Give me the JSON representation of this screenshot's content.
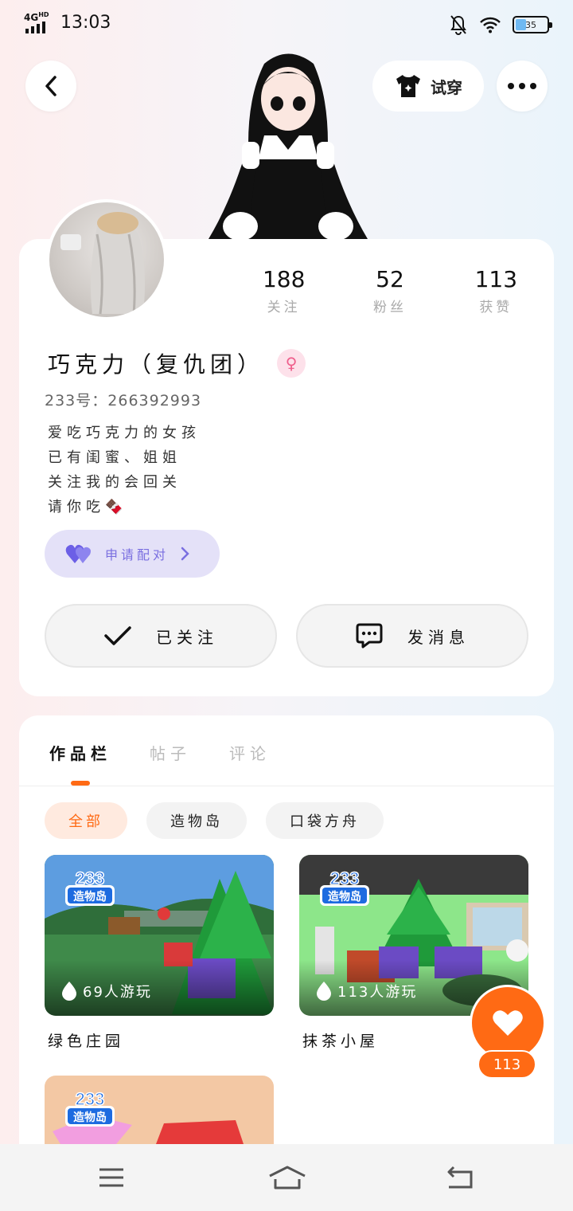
{
  "status_bar": {
    "network": "4G",
    "network_sub": "HD",
    "time": "13:03",
    "battery": "35"
  },
  "header": {
    "try_on_label": "试穿"
  },
  "profile": {
    "stats": [
      {
        "value": "188",
        "label": "关注"
      },
      {
        "value": "52",
        "label": "粉丝"
      },
      {
        "value": "113",
        "label": "获赞"
      }
    ],
    "name": "巧克力（复仇团）",
    "uid": "233号：266392993",
    "bio": [
      "爱吃巧克力的女孩",
      "已有闺蜜、姐姐",
      "关注我的会回关",
      "请你吃🍫"
    ],
    "match_label": "申请配对",
    "follow_label": "已关注",
    "message_label": "发消息"
  },
  "tabs": [
    {
      "label": "作品栏"
    },
    {
      "label": "帖子"
    },
    {
      "label": "评论"
    }
  ],
  "chips": [
    {
      "label": "全部"
    },
    {
      "label": "造物岛"
    },
    {
      "label": "口袋方舟"
    }
  ],
  "games": [
    {
      "plays": "69人游玩",
      "title": "绿色庄园"
    },
    {
      "plays": "113人游玩",
      "title": "抹茶小屋"
    }
  ],
  "logo_text": {
    "top": "233",
    "bottom": "造物岛"
  },
  "like_count": "113",
  "colors": {
    "accent": "#ff6a14",
    "match": "#7a6fe0",
    "gender": "#ef5f8c"
  }
}
